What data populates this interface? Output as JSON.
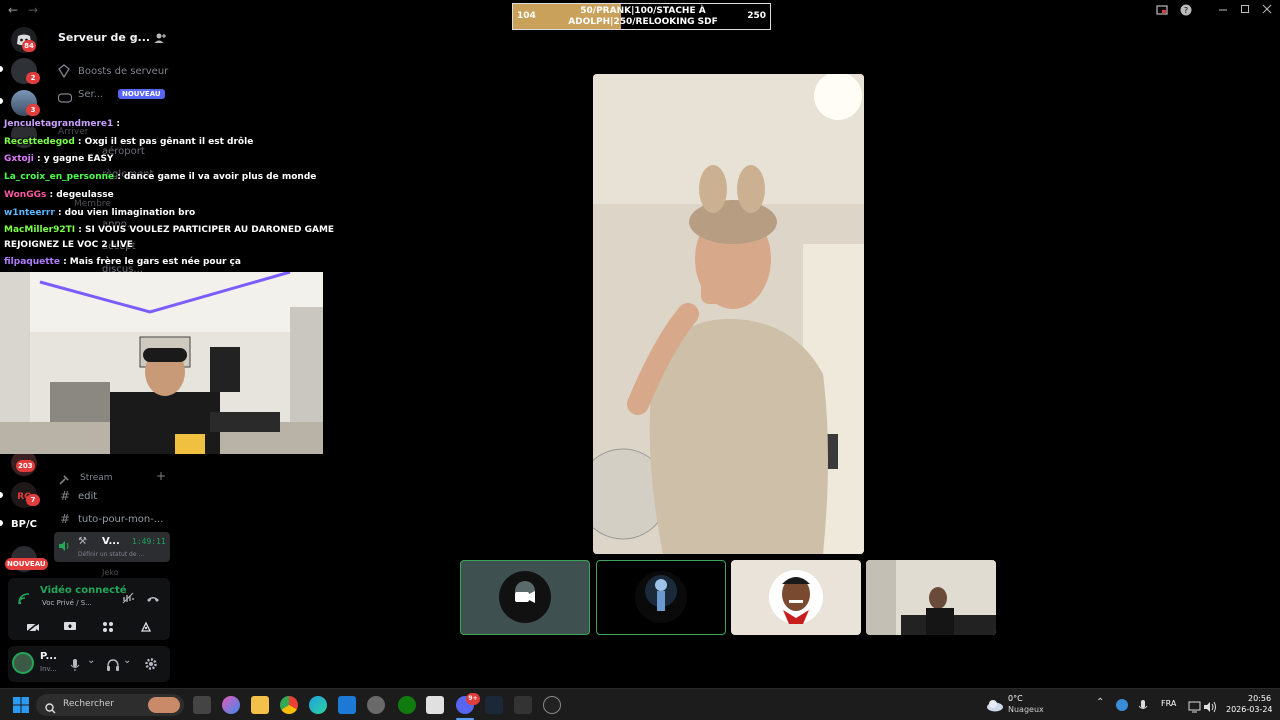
{
  "window": {
    "back_glyph": "←",
    "forward_glyph": "→"
  },
  "goal": {
    "start": "104",
    "end": "250",
    "title": "50/PRANK|100/STACHE À ADOLPH|250/RELOOKING SDF",
    "progress": 0.42
  },
  "server": {
    "name": "Serveur de g...",
    "boosts_label": "Boosts de serveur",
    "ser_label": "Ser...",
    "nouveau_badge": "NOUVEAU",
    "bg_labels": [
      "Arriver",
      "aéroport",
      "règlement",
      "Membre",
      "anno...",
      "accept",
      "discus..."
    ],
    "category_stream": "Stream",
    "channels": [
      "edit",
      "tuto-pour-mon-..."
    ],
    "voice_channel": "V...",
    "voice_timer": "1:49:11",
    "voice_status": "Définir un statut de ...",
    "voice_member": "Jeko"
  },
  "rail": {
    "badges": [
      "84",
      "2",
      "3",
      "203",
      "7"
    ],
    "bpc_label": "BP/C",
    "nouveau_label": "NOUVEAU"
  },
  "chat": [
    {
      "user": "Jenculetagrandmere1",
      "text": " : ",
      "color": "#c9a0ff"
    },
    {
      "user": "Recettedegod",
      "text": " : Oxgi il est pas gênant il est drôle",
      "color": "#7cff4a"
    },
    {
      "user": "Gxtoji",
      "text": " : y gagne EASY",
      "color": "#e07cff"
    },
    {
      "user": "La_croix_en_personne",
      "text": " : dance game il va avoir plus de monde",
      "color": "#4aff4a"
    },
    {
      "user": "WonGGs",
      "text": " : degeulasse",
      "color": "#ff5aa0"
    },
    {
      "user": "w1nteerrr",
      "text": " : dou vien limagination bro",
      "color": "#5ab8ff"
    },
    {
      "user": "MacMiller92TI",
      "text": " : SI VOUS VOULEZ PARTICIPER AU DARONED GAME",
      "color": "#7cff4a"
    },
    {
      "user": "",
      "text": "REJOIGNEZ LE VOC 2 LIVE",
      "color": "#ffffff"
    },
    {
      "user": "filpaquette",
      "text": " : Mais frère le gars est née pour ça",
      "color": "#b07cff"
    }
  ],
  "voice": {
    "connected_label": "Vidéo connecté",
    "location": "Voc Privé / S..."
  },
  "user": {
    "name": "P...",
    "status": "Inv..."
  },
  "taskbar": {
    "search_placeholder": "Rechercher",
    "weather_temp": "0°C",
    "weather_desc": "Nuageux",
    "language": "FRA",
    "time": "20:56",
    "date": "2026-03-24",
    "discord_badge": "9+"
  },
  "colors": {
    "accent": "#5865f2",
    "green": "#23a55a",
    "red": "#e23c3c",
    "tile_border": "#3ba55c"
  }
}
